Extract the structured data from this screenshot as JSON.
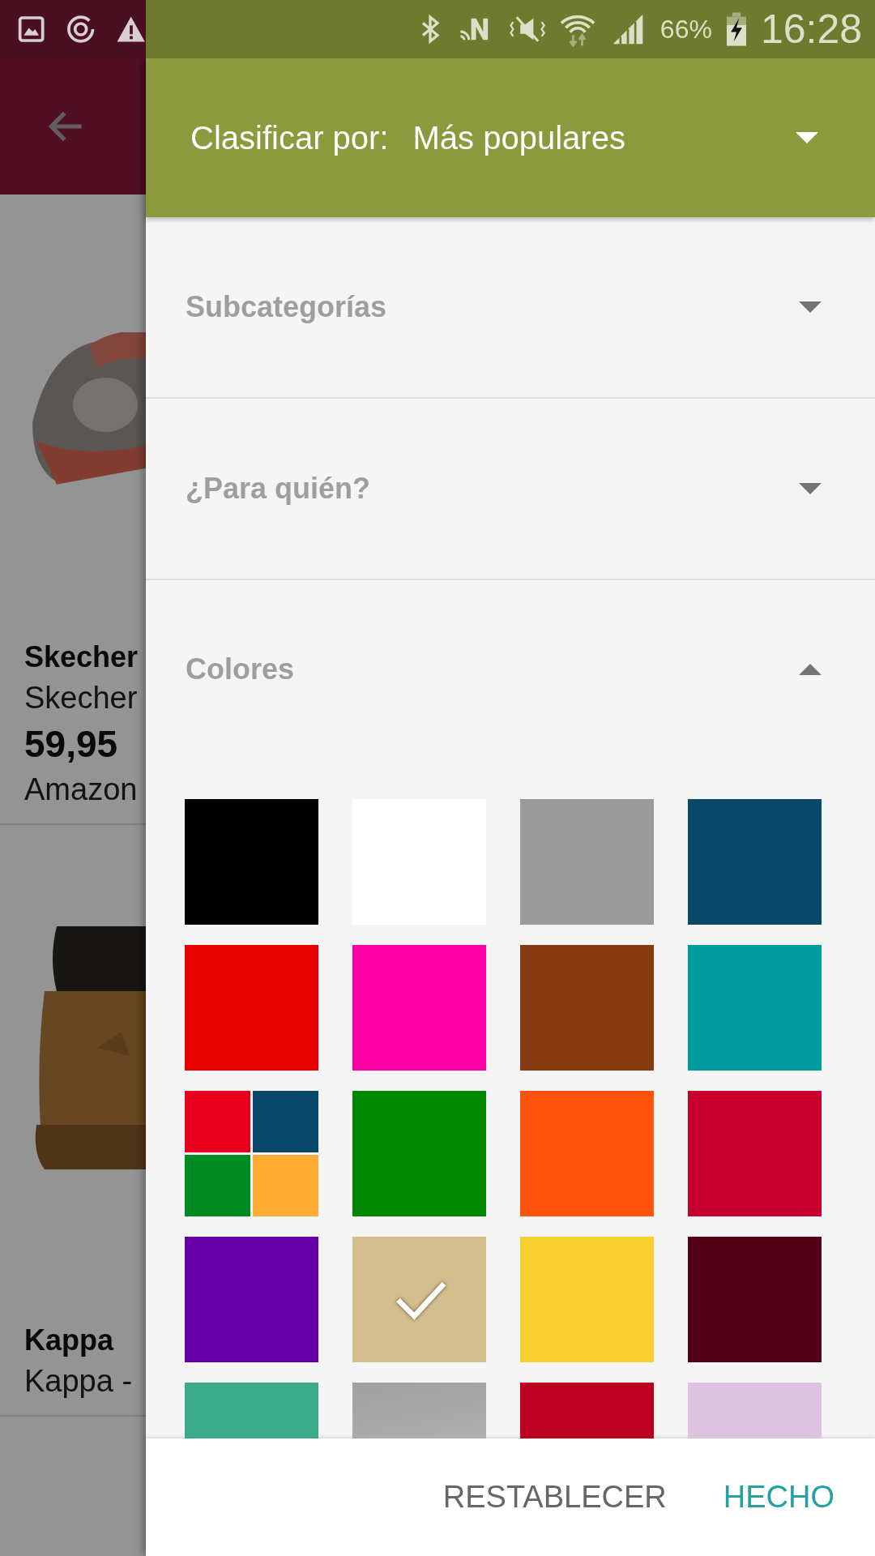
{
  "status_bar": {
    "battery": "66%",
    "time": "16:28"
  },
  "background_list": {
    "items": [
      {
        "kind": "picture",
        "title": "Skecher",
        "subtitle": "Skecher",
        "price": "59,95",
        "store": "Amazon"
      },
      {
        "kind": "picture",
        "title": "Kappa",
        "subtitle": "Kappa -"
      }
    ]
  },
  "sort_header": {
    "label": "Clasificar por:",
    "value": "Más populares"
  },
  "filters": [
    {
      "label": "Subcategorías",
      "expanded": false
    },
    {
      "label": "¿Para quién?",
      "expanded": false
    },
    {
      "label": "Colores",
      "expanded": true
    }
  ],
  "colors": [
    {
      "kind": "solid",
      "color": "#000000",
      "selected": false
    },
    {
      "kind": "solid",
      "color": "#ffffff",
      "selected": false
    },
    {
      "kind": "solid",
      "color": "#9b9b9b",
      "selected": false
    },
    {
      "kind": "solid",
      "color": "#084869",
      "selected": false
    },
    {
      "kind": "solid",
      "color": "#e80000",
      "selected": false
    },
    {
      "kind": "solid",
      "color": "#ff00a6",
      "selected": false
    },
    {
      "kind": "solid",
      "color": "#873b13",
      "selected": false
    },
    {
      "kind": "solid",
      "color": "#009d9e",
      "selected": false
    },
    {
      "kind": "multi",
      "selected": false
    },
    {
      "kind": "solid",
      "color": "#008700",
      "selected": false
    },
    {
      "kind": "solid",
      "color": "#ff520a",
      "selected": false
    },
    {
      "kind": "solid",
      "color": "#c9002f",
      "selected": false
    },
    {
      "kind": "solid",
      "color": "#6600a8",
      "selected": false
    },
    {
      "kind": "solid",
      "color": "#d4be8e",
      "selected": true
    },
    {
      "kind": "solid",
      "color": "#f8d030",
      "selected": false
    },
    {
      "kind": "solid",
      "color": "#52001a",
      "selected": false
    },
    {
      "kind": "solid",
      "color": "#3aab89",
      "selected": false
    },
    {
      "kind": "gradient",
      "color": "#a0a0a0",
      "selected": false
    },
    {
      "kind": "solid",
      "color": "#bb0020",
      "selected": false
    },
    {
      "kind": "solid",
      "color": "#dcc3df",
      "selected": false
    }
  ],
  "buttons": [
    {
      "label": "RESTABLECER",
      "kind": "secondary"
    },
    {
      "label": "HECHO",
      "kind": "primary"
    }
  ]
}
